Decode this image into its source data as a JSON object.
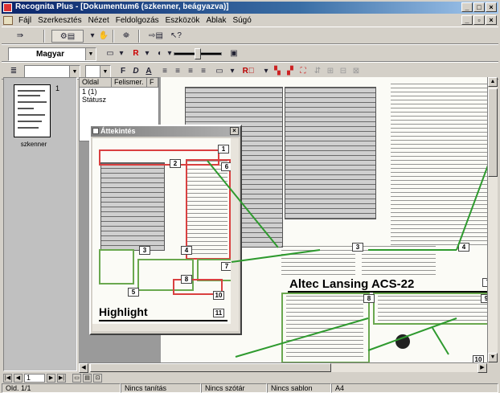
{
  "window": {
    "title": "Recognita Plus - [Dokumentum6 (szkenner, beágyazva)]",
    "controls": [
      "_",
      "□",
      "×"
    ],
    "mdi_controls": [
      "_",
      "▫",
      "×"
    ]
  },
  "menu": {
    "items": [
      "Fájl",
      "Szerkesztés",
      "Nézet",
      "Feldolgozás",
      "Eszközök",
      "Ablak",
      "Súgó"
    ]
  },
  "toolbar2": {
    "language_combo": "Magyar"
  },
  "file_list": {
    "headers": [
      "Oldal",
      "Felismer.",
      "F"
    ],
    "rows": [
      [
        "1 (1)",
        "",
        ""
      ],
      [
        "Státusz",
        "",
        ""
      ]
    ]
  },
  "thumbnail": {
    "page_number": "1",
    "caption": "szkenner"
  },
  "overview": {
    "title": "Áttekintés",
    "close": "×",
    "headline": "Highlight"
  },
  "page": {
    "headline": "Altec Lansing ACS-22",
    "zone_labels": [
      "1",
      "2",
      "3",
      "4",
      "5",
      "6",
      "7",
      "8",
      "9",
      "10",
      "11"
    ]
  },
  "navigator": {
    "current_page": "1"
  },
  "status": {
    "cells": [
      "Old. 1/1",
      "Nincs tanítás",
      "Nincs szótár",
      "Nincs sablon",
      "A4"
    ]
  }
}
